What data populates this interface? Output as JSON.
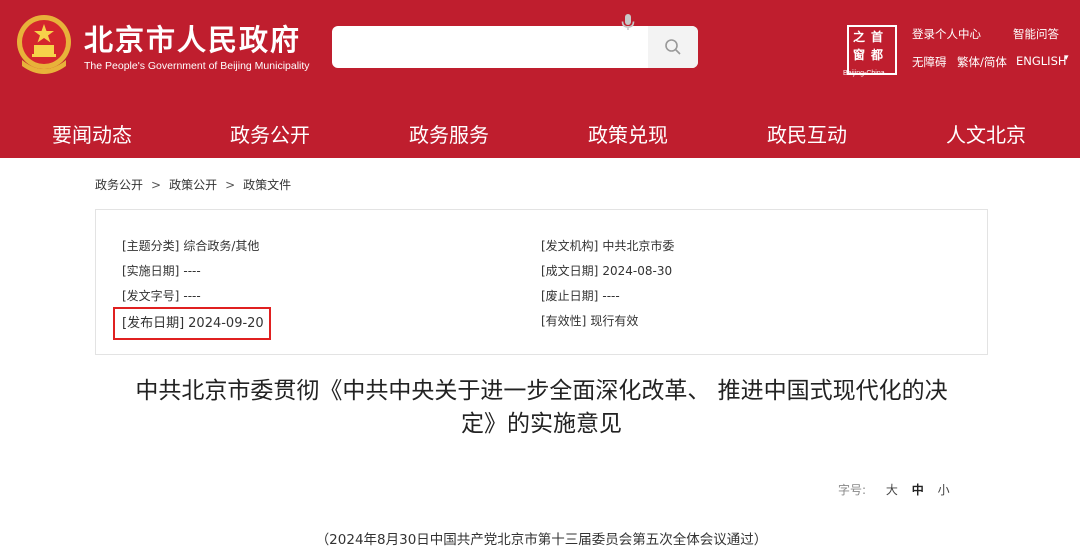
{
  "header": {
    "site_title": "北京市人民政府",
    "site_subtitle": "The People's Government of Beijing Municipality",
    "search": {
      "value": "",
      "placeholder": ""
    },
    "logo_chars": [
      "首",
      "都",
      "之",
      "窗"
    ],
    "logo_caption": "Beijing-China",
    "links": {
      "login": "登录个人中心",
      "qa": "智能问答",
      "accessible": "无障碍",
      "trad_simp": "繁体/简体",
      "english": "ENGLISH"
    }
  },
  "nav": {
    "items": [
      "要闻动态",
      "政务公开",
      "政务服务",
      "政策兑现",
      "政民互动",
      "人文北京"
    ]
  },
  "breadcrumb": {
    "items": [
      "政务公开",
      "政策公开",
      "政策文件"
    ],
    "separator": ">"
  },
  "meta": {
    "topic": {
      "label": "[主题分类]",
      "value": "综合政务/其他"
    },
    "issuer": {
      "label": "[发文机构]",
      "value": "中共北京市委"
    },
    "impl_date": {
      "label": "[实施日期]",
      "value": "----"
    },
    "written_date": {
      "label": "[成文日期]",
      "value": "2024-08-30"
    },
    "doc_no": {
      "label": "[发文字号]",
      "value": "----"
    },
    "repeal_date": {
      "label": "[废止日期]",
      "value": "----"
    },
    "publish_date": {
      "label": "[发布日期]",
      "value": "2024-09-20"
    },
    "validity": {
      "label": "[有效性]",
      "value": "现行有效"
    }
  },
  "document": {
    "title_line1": "中共北京市委贯彻《中共中央关于进一步全面深化改革、 推进中国式现代化的决",
    "title_line2": "定》的实施意见",
    "font_size": {
      "label": "字号:",
      "options": [
        "大",
        "中",
        "小"
      ],
      "selected": "中"
    },
    "note": "（2024年8月30日中国共产党北京市第十三届委员会第五次全体会议通过）"
  },
  "colors": {
    "brand_red": "#bf1e2e",
    "highlight_border": "#e02020"
  }
}
